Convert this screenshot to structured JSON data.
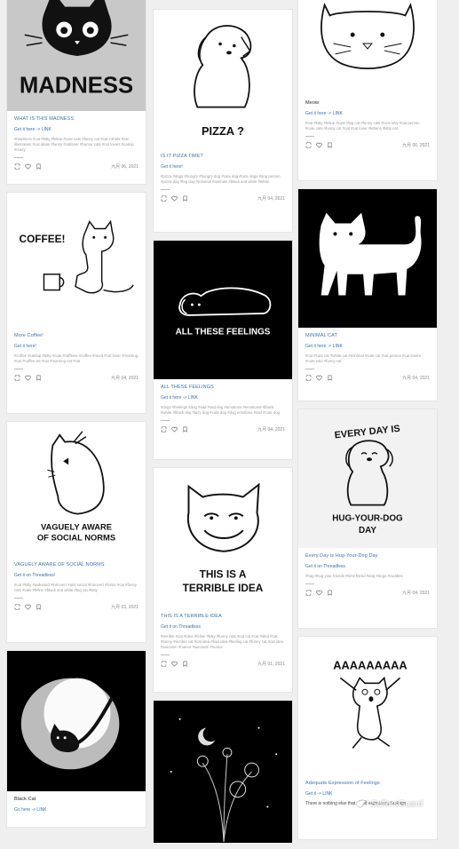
{
  "cards": [
    {
      "col": 1,
      "title": "WHAT IS THIS MADNESS",
      "link": "Get it here -> LINK",
      "tags": "#madness #cat #kitty #feline #cute cats #funny cat #cat t-shirts #cat illustration #cat ideas #funny #catlover #humor cats #cat lovers #catnip #crazy",
      "date": "九月 06, 2021",
      "image_text": "MADNESS"
    },
    {
      "col": 1,
      "title": "More Coffee!",
      "link": "Get it here!",
      "tags": "#coffee #catsup #kitty #cute #caffeine #coffee #need #cat lover #morning #cat #coffee art #cat #morning cat #cat",
      "date": "九月 04, 2021",
      "image_text": "COFFEE!"
    },
    {
      "col": 1,
      "title": "VAGUELY AWARE OF SOCIAL NORMS",
      "link": "Get it on Threadless!",
      "tags": "#cat #kitty #awkward #introvert #anti social #introvert #feline #cat #funny cats #cats #feline #black and white #big cat #kitty",
      "date": "九月 03, 2021",
      "image_text": [
        "VAGUELY AWARE",
        "OF SOCIAL NORMS"
      ]
    },
    {
      "col": 1,
      "title": "Black Cat",
      "link": "Go here -> LINK",
      "date": "",
      "image_text": ""
    },
    {
      "col": 2,
      "title": "IS IT PIZZA TIME?",
      "link": "Get it here!",
      "tags": "#pizza #dogs #hungry #hungry dog #cute dog #cute dogs #dog person #pizza dog #big dog #minimal #animals #black and white #white",
      "date": "九月 04, 2021",
      "image_text": "PIZZA ?"
    },
    {
      "col": 2,
      "title": "ALL THESE FEELINGS",
      "link": "Get it here -> LINK",
      "tags": "#dogs #feelings #dog #sad #sad dog #emotions #emotional #black #white #black dog #lazy dog #cute dog #dog emotions #sad #cute dog",
      "date": "九月 04, 2021",
      "image_text": "ALL THESE FEELINGS"
    },
    {
      "col": 2,
      "title": "THIS IS A TERRIBLE IDEA",
      "link": "Get it on Threadless",
      "tags": "#terrible #cat #idea #feline #kitty #funny cats #cat cat #cat #idea #cat #funny #terrible cat #cat idea #bad idea #feeling cat #funny cat #cat idea #sarcasm #humor #sarcasm #humor",
      "date": "九月 01, 2021",
      "image_text": [
        "THIS IS A",
        "TERRIBLE IDEA"
      ]
    },
    {
      "col": 2,
      "title": "",
      "link": "",
      "date": "",
      "image_text": ""
    },
    {
      "col": 3,
      "title": "Meow",
      "link": "Get it here -> LINK",
      "tags": "#cat #kitty #feline #cute #big cat #funny cats #cute kitty #cat person #cute cats #funny cat #cat #cat lover #kittens #kitty cat",
      "date": "九月 06, 2021",
      "image_text": ""
    },
    {
      "col": 3,
      "title": "MINIMAL CAT",
      "link": "Get it here -> LINK",
      "tags": "#cat #cute cat #white cat #minimal #cute cat #cat person #cat lovers #cute cats #funny cat",
      "date": "九月 04, 2021",
      "image_text": ""
    },
    {
      "col": 3,
      "title": "Every Day is Hug-Your-Dog Day",
      "link": "Get it on Threadless",
      "tags": "#hug #hug your friends #best friend #dog #dogs #cuddles",
      "date": "九月 04, 2021",
      "image_text": [
        "EVERY DAY IS",
        "HUG-YOUR-DOG",
        "DAY"
      ]
    },
    {
      "col": 3,
      "title": "Adequate Expression of Feelings",
      "link": "Get it -> LINK",
      "desc": "There is nothing else that could explain my feelings",
      "date": "",
      "image_text": "AAAAAAAAA"
    }
  ],
  "icons": [
    "share-icon",
    "heart-icon",
    "bookmark-icon"
  ],
  "watermark": {
    "label": "SellersGuard"
  }
}
